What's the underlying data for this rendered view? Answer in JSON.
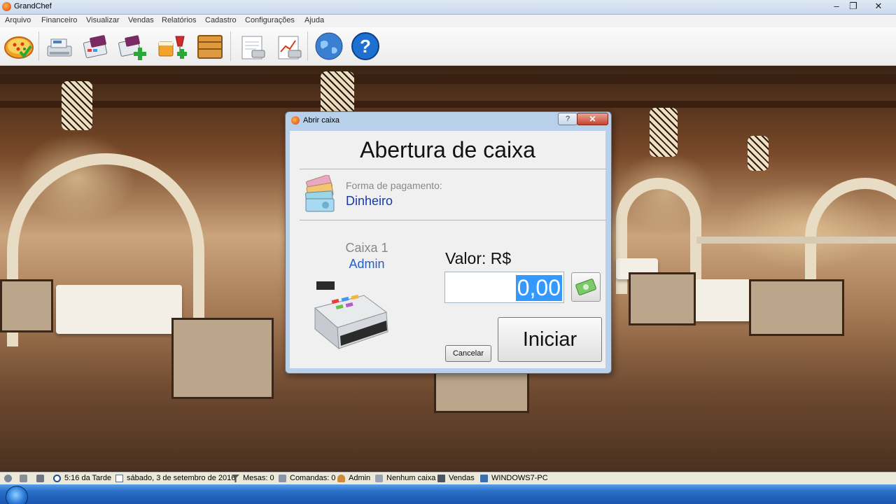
{
  "window": {
    "title": "GrandChef"
  },
  "menu": [
    "Arquivo",
    "Financeiro",
    "Visualizar",
    "Vendas",
    "Relatórios",
    "Cadastro",
    "Configurações",
    "Ajuda"
  ],
  "dialog": {
    "title": "Abrir caixa",
    "heading": "Abertura de caixa",
    "payment_label": "Forma de pagamento:",
    "payment_value": "Dinheiro",
    "register_name": "Caixa 1",
    "register_user": "Admin",
    "value_label": "Valor: R$",
    "value_input": "0,00",
    "cancel_label": "Cancelar",
    "start_label": "Iniciar"
  },
  "status": {
    "time": "5:16 da Tarde",
    "date": "sábado, 3 de setembro de 2016",
    "tables": "Mesas: 0",
    "orders": "Comandas: 0",
    "user": "Admin",
    "register": "Nenhum caixa",
    "sales": "Vendas",
    "computer": "WINDOWS7-PC"
  },
  "icons": {
    "toolbar": [
      "pizza-icon",
      "cash-register-icon",
      "card-payment-icon",
      "add-payment-icon",
      "drinks-icon",
      "box-icon",
      "report-icon",
      "chart-report-icon",
      "globe-icon",
      "help-icon"
    ],
    "dialog": [
      "money-notes-icon",
      "cash-register-icon",
      "cash-icon"
    ]
  },
  "colors": {
    "accent_blue": "#1638a8",
    "selection": "#3399ff",
    "close_red": "#c7452f"
  }
}
